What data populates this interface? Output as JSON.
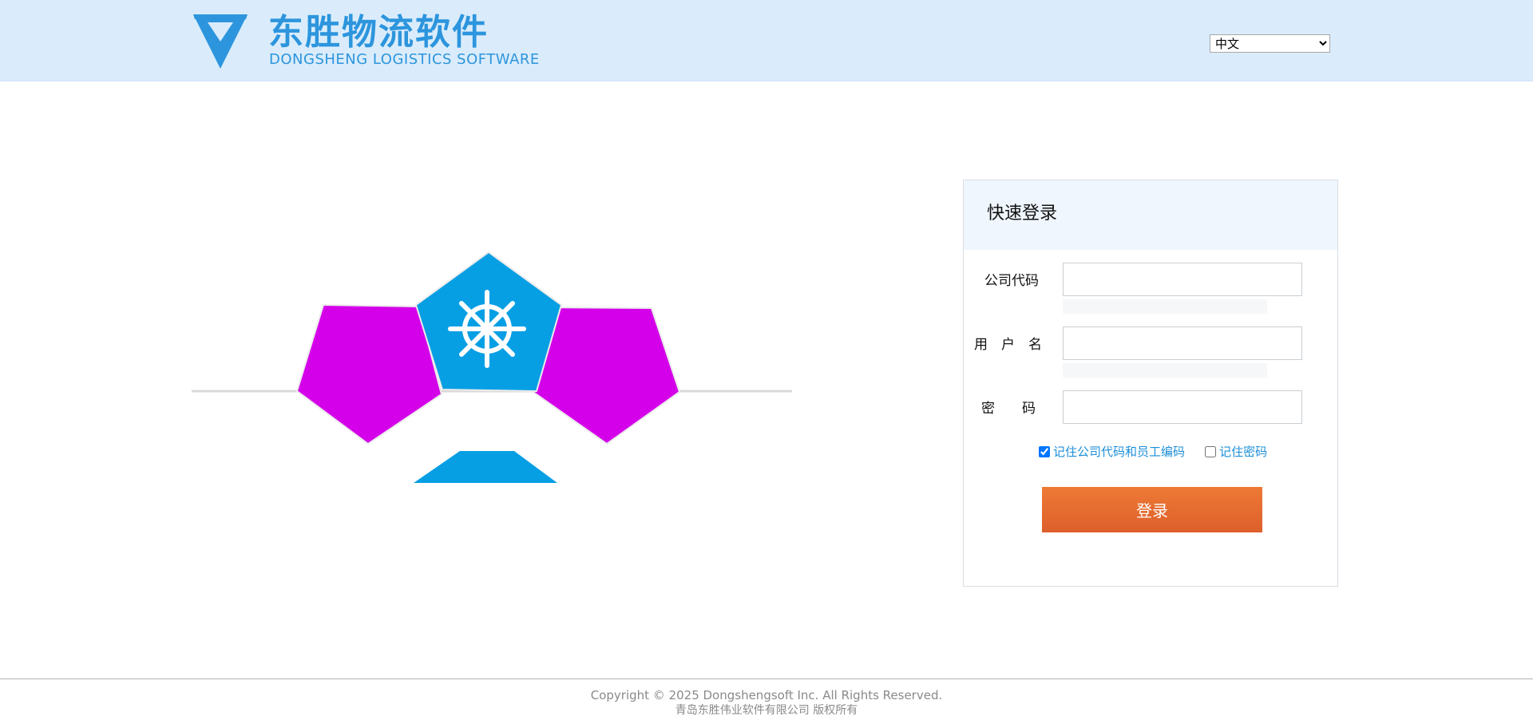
{
  "header": {
    "logo_cn": "东胜物流软件",
    "logo_en": "DONGSHENG LOGISTICS SOFTWARE",
    "brand_color": "#2c95dd",
    "language": {
      "selected": "中文"
    }
  },
  "hero": {
    "icon": "ship-wheel-icon",
    "colors": {
      "blue": "#079fe4",
      "magenta": "#d500ea",
      "line": "#d9d9d9"
    }
  },
  "login": {
    "title": "快速登录",
    "company_code_label": "公司代码",
    "username_label": "用　户　名",
    "password_label": "密　　码",
    "remember_company_label": "记住公司代码和员工编码",
    "remember_company_checked": true,
    "remember_password_label": "记住密码",
    "remember_password_checked": false,
    "submit_label": "登录",
    "button_color": "#e56a30"
  },
  "footer": {
    "copyright": "Copyright © 2025 Dongshengsoft Inc. All Rights Reserved.",
    "company": "青岛东胜伟业软件有限公司 版权所有"
  }
}
